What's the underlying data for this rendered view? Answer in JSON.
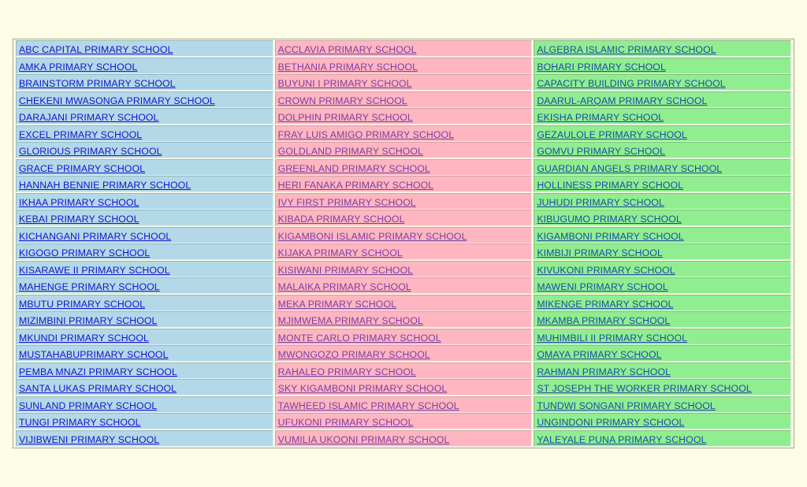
{
  "page": {
    "background_color": "#fdfce4",
    "table_border_color": "#a8a88c"
  },
  "columns": [
    {
      "id": "column-1",
      "background_color": "#b3d9e8",
      "link_color": "#1414cc",
      "items": [
        "ABC CAPITAL PRIMARY SCHOOL",
        "AMKA PRIMARY SCHOOL",
        "BRAINSTORM PRIMARY SCHOOL",
        "CHEKENI MWASONGA PRIMARY SCHOOL",
        "DARAJANI PRIMARY SCHOOL",
        "EXCEL PRIMARY SCHOOL",
        "GLORIOUS PRIMARY SCHOOL",
        "GRACE PRIMARY SCHOOL",
        "HANNAH BENNIE PRIMARY SCHOOL",
        "IKHAA PRIMARY SCHOOL",
        "KEBAI PRIMARY SCHOOL",
        "KICHANGANI PRIMARY SCHOOL",
        "KIGOGO PRIMARY SCHOOL",
        "KISARAWE II PRIMARY SCHOOL",
        "MAHENGE PRIMARY SCHOOL",
        "MBUTU PRIMARY SCHOOL",
        "MIZIMBINI PRIMARY SCHOOL",
        "MKUNDI PRIMARY SCHOOL",
        "MUSTAHABUPRIMARY SCHOOL",
        "PEMBA MNAZI PRIMARY SCHOOL",
        "SANTA LUKAS PRIMARY SCHOOL",
        "SUNLAND PRIMARY SCHOOL",
        "TUNGI PRIMARY SCHOOL",
        "VIJIBWENI PRIMARY SCHOOL"
      ]
    },
    {
      "id": "column-2",
      "background_color": "#ffb6c1",
      "link_color": "#7b3fa0",
      "items": [
        "ACCLAVIA PRIMARY SCHOOL",
        "BETHANIA PRIMARY SCHOOL",
        "BUYUNI I PRIMARY SCHOOL",
        "CROWN PRIMARY SCHOOL",
        "DOLPHIN PRIMARY SCHOOL",
        "FRAY LUIS AMIGO PRIMARY SCHOOL",
        "GOLDLAND PRIMARY SCHOOL",
        "GREENLAND PRIMARY SCHOOL",
        "HERI FANAKA PRIMARY SCHOOL",
        "IVY FIRST PRIMARY SCHOOL",
        "KIBADA PRIMARY SCHOOL",
        "KIGAMBONI ISLAMIC PRIMARY SCHOOL",
        "KIJAKA PRIMARY SCHOOL",
        "KISIWANI PRIMARY SCHOOL",
        "MALAIKA PRIMARY SCHOOL",
        "MEKA PRIMARY SCHOOL",
        "MJIMWEMA PRIMARY SCHOOL",
        "MONTE CARLO PRIMARY SCHOOL",
        "MWONGOZO PRIMARY SCHOOL",
        "RAHALEO PRIMARY SCHOOL",
        "SKY KIGAMBONI PRIMARY SCHOOL",
        "TAWHEED ISLAMIC PRIMARY SCHOOL",
        "UFUKONI PRIMARY SCHOOL",
        "VUMILIA UKOONI PRIMARY SCHOOL"
      ]
    },
    {
      "id": "column-3",
      "background_color": "#90ee90",
      "link_color": "#1a4fa0",
      "items": [
        "ALGEBRA ISLAMIC PRIMARY SCHOOL",
        "BOHARI PRIMARY SCHOOL",
        "CAPACITY BUILDING PRIMARY SCHOOL",
        "DAARUL-ARQAM PRIMARY SCHOOL",
        "EKISHA PRIMARY SCHOOL",
        "GEZAULOLE PRIMARY SCHOOL",
        "GOMVU PRIMARY SCHOOL",
        "GUARDIAN ANGELS PRIMARY SCHOOL",
        "HOLLINESS PRIMARY SCHOOL",
        "JUHUDI PRIMARY SCHOOL",
        "KIBUGUMO PRIMARY SCHOOL",
        "KIGAMBONI PRIMARY SCHOOL",
        "KIMBIJI PRIMARY SCHOOL",
        "KIVUKONI PRIMARY SCHOOL",
        "MAWENI PRIMARY SCHOOL",
        "MIKENGE PRIMARY SCHOOL",
        "MKAMBA PRIMARY SCHOOL",
        "MUHIMBILI II PRIMARY SCHOOL",
        "OMAYA PRIMARY SCHOOL",
        "RAHMAN PRIMARY SCHOOL",
        "ST JOSEPH THE WORKER PRIMARY SCHOOL",
        "TUNDWI SONGANI PRIMARY SCHOOL",
        "UNGINDONI PRIMARY SCHOOL",
        "YALEYALE PUNA PRIMARY SCHOOL"
      ]
    }
  ]
}
